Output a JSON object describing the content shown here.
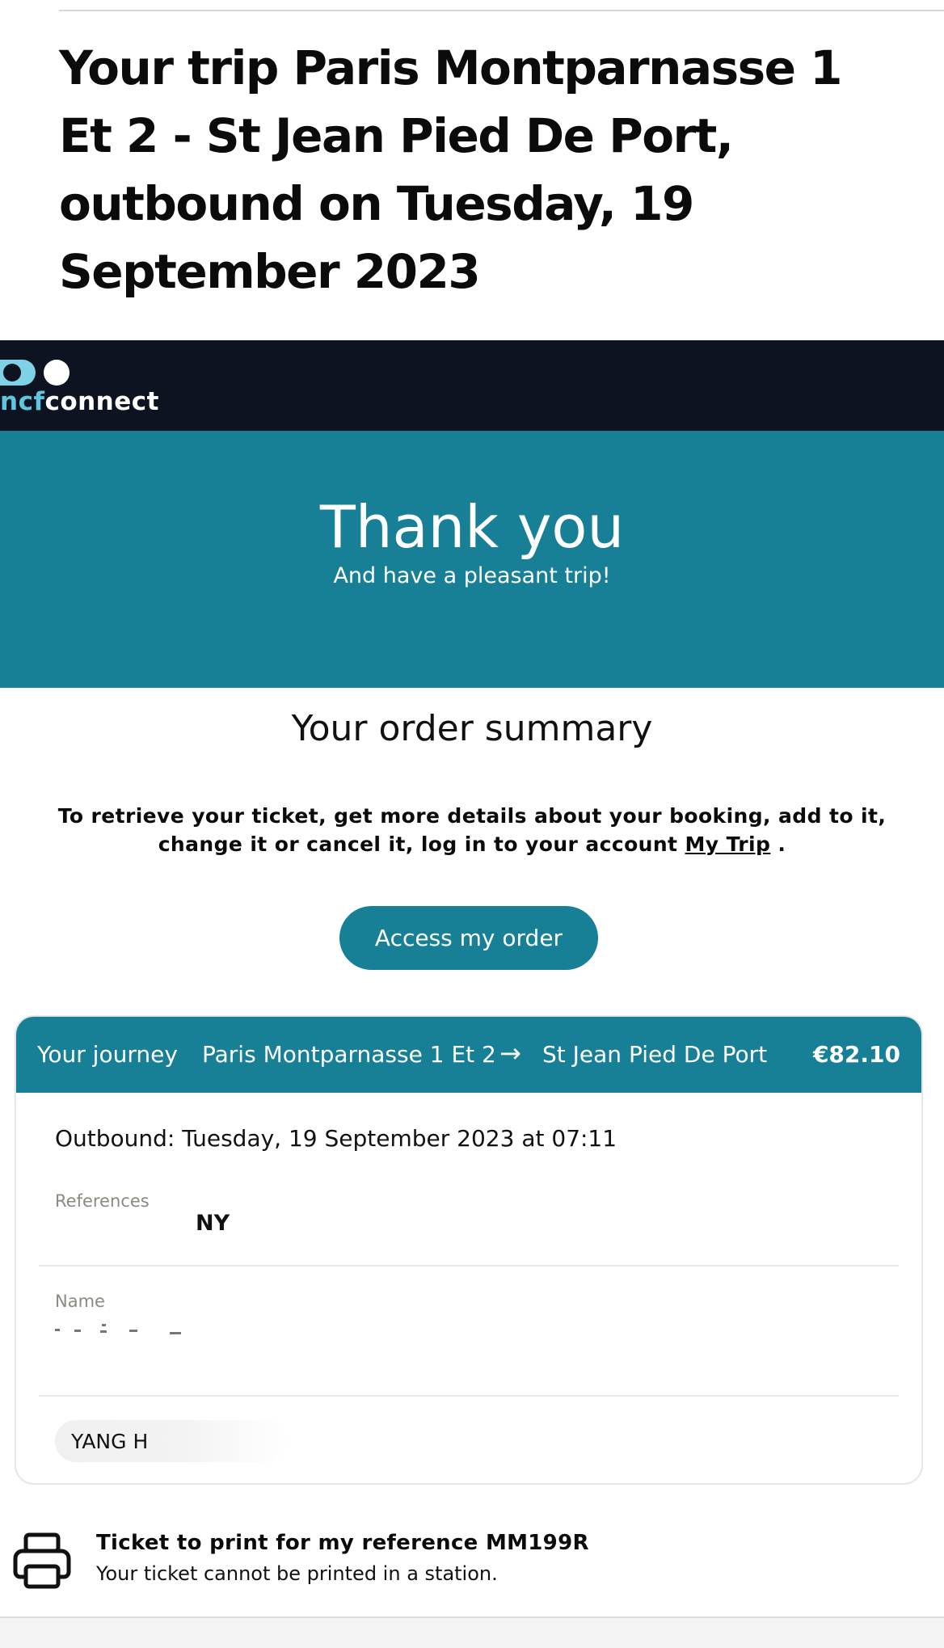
{
  "email": {
    "title": "Your trip Paris Montparnasse 1 Et 2 - St Jean Pied De Port, outbound on Tuesday, 19 September 2023"
  },
  "brand": {
    "logo_prefix": "ncf",
    "logo_suffix": "connect",
    "colors": {
      "bar": "#0d1321",
      "accent": "#177f96",
      "logo_accent": "#7fd2e6"
    }
  },
  "hero": {
    "title": "Thank you",
    "subtitle": "And have a pleasant trip!"
  },
  "summary": {
    "title": "Your order summary",
    "retrieve_text": "To retrieve your ticket, get more details about your booking, add to it, change it or cancel it, log in to your account",
    "retrieve_link": "My Trip",
    "retrieve_end": ".",
    "access_button": "Access my order"
  },
  "journey": {
    "label": "Your journey",
    "from": "Paris Montparnasse 1 Et 2",
    "arrow_icon": "arrow-right-icon",
    "to": "St Jean Pied De Port",
    "price": "€82.10",
    "outbound": "Outbound: Tuesday, 19 September 2023 at 07:11",
    "references_label": "References",
    "references_value": "NY",
    "name_label": "Name",
    "passenger": "YANG H"
  },
  "ticket": {
    "icon": "printer-icon",
    "title": "Ticket to print for my reference MM199R",
    "subtitle": "Your ticket cannot be printed in a station."
  }
}
